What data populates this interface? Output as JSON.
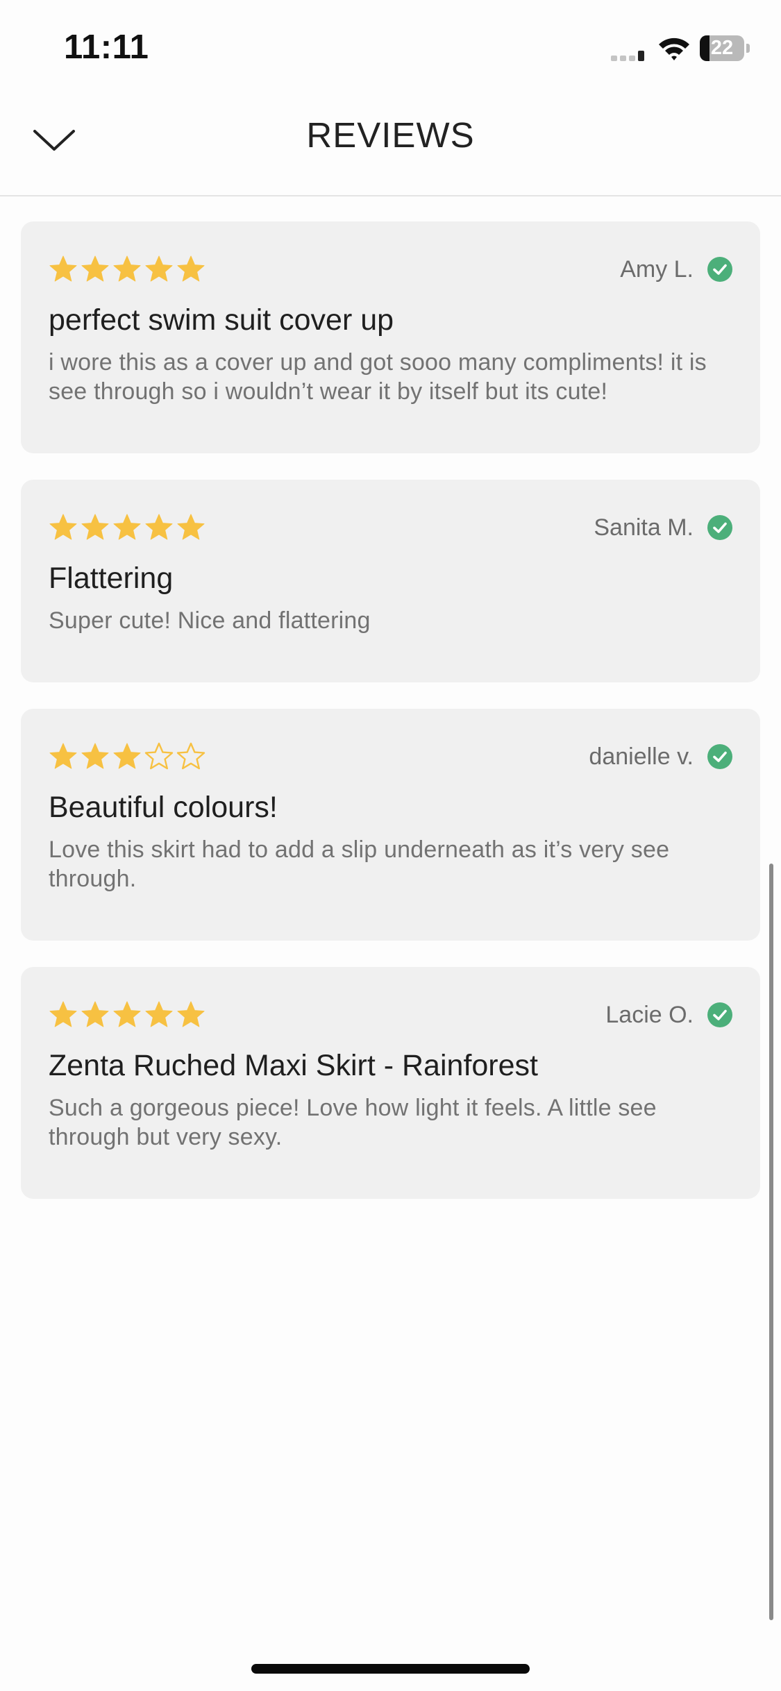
{
  "status_bar": {
    "time": "11:11",
    "battery_percent": "22",
    "battery_level": 0.22,
    "icons": [
      "signal-icon",
      "wifi-icon",
      "battery-icon"
    ]
  },
  "header": {
    "title": "REVIEWS",
    "back_icon": "chevron-down-icon"
  },
  "colors": {
    "star": "#f7c142",
    "verified": "#4caf7a",
    "card_bg": "#f0f0f0"
  },
  "reviews": [
    {
      "rating": 5,
      "reviewer": "Amy L.",
      "verified": true,
      "title": "perfect swim suit cover up",
      "body": "i wore this as a cover up and got sooo many compliments! it is see through so i wouldn’t wear it by itself but its cute!"
    },
    {
      "rating": 5,
      "reviewer": "Sanita M.",
      "verified": true,
      "title": "Flattering",
      "body": "Super cute! Nice and flattering"
    },
    {
      "rating": 3,
      "reviewer": "danielle v.",
      "verified": true,
      "title": "Beautiful colours!",
      "body": "Love this skirt had to add a slip underneath as it’s very see through."
    },
    {
      "rating": 5,
      "reviewer": "Lacie O.",
      "verified": true,
      "title": "Zenta Ruched Maxi Skirt - Rainforest",
      "body": "Such a gorgeous piece! Love how light it feels. A little see through but very sexy."
    }
  ]
}
